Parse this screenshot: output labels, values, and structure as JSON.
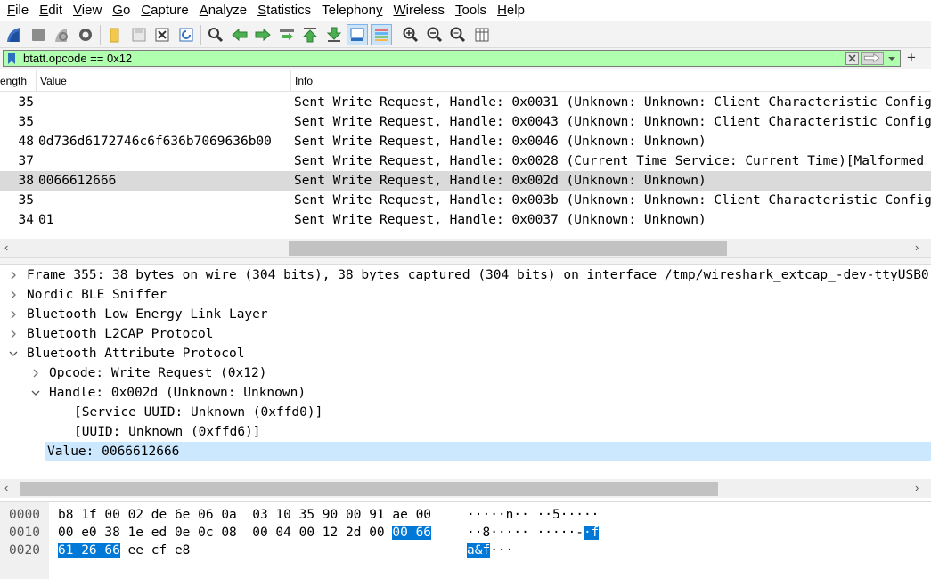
{
  "menu": [
    {
      "pre": "",
      "ul": "F",
      "post": "ile"
    },
    {
      "pre": "",
      "ul": "E",
      "post": "dit"
    },
    {
      "pre": "",
      "ul": "V",
      "post": "iew"
    },
    {
      "pre": "",
      "ul": "G",
      "post": "o"
    },
    {
      "pre": "",
      "ul": "C",
      "post": "apture"
    },
    {
      "pre": "",
      "ul": "A",
      "post": "nalyze"
    },
    {
      "pre": "",
      "ul": "S",
      "post": "tatistics"
    },
    {
      "pre": "Telephon",
      "ul": "y",
      "post": ""
    },
    {
      "pre": "",
      "ul": "W",
      "post": "ireless"
    },
    {
      "pre": "",
      "ul": "T",
      "post": "ools"
    },
    {
      "pre": "",
      "ul": "H",
      "post": "elp"
    }
  ],
  "toolbar_icons": [
    "start-capture-icon",
    "stop-capture-icon",
    "restart-capture-icon",
    "capture-options-icon",
    "open-file-icon",
    "save-file-icon",
    "close-file-icon",
    "reload-file-icon",
    "find-packet-icon",
    "go-back-icon",
    "go-forward-icon",
    "go-to-packet-icon",
    "go-first-icon",
    "go-last-icon",
    "autoscroll-icon",
    "colorize-icon",
    "zoom-in-icon",
    "zoom-out-icon",
    "zoom-normal-icon",
    "resize-columns-icon"
  ],
  "filter": {
    "value": "btatt.opcode == 0x12",
    "add_label": "+"
  },
  "packet_list": {
    "columns": [
      "ength",
      "Value",
      "Info"
    ],
    "rows": [
      {
        "length": "35",
        "value": "",
        "info": "Sent Write Request, Handle: 0x0031 (Unknown: Unknown: Client Characteristic Configuration)",
        "selected": false
      },
      {
        "length": "35",
        "value": "",
        "info": "Sent Write Request, Handle: 0x0043 (Unknown: Unknown: Client Characteristic Configuration)",
        "selected": false
      },
      {
        "length": "48",
        "value": "0d736d6172746c6f636b7069636b00",
        "info": "Sent Write Request, Handle: 0x0046 (Unknown: Unknown)",
        "selected": false
      },
      {
        "length": "37",
        "value": "",
        "info": "Sent Write Request, Handle: 0x0028 (Current Time Service: Current Time)[Malformed Packet]",
        "selected": false
      },
      {
        "length": "38",
        "value": "0066612666",
        "info": "Sent Write Request, Handle: 0x002d (Unknown: Unknown)",
        "selected": true
      },
      {
        "length": "35",
        "value": "",
        "info": "Sent Write Request, Handle: 0x003b (Unknown: Unknown: Client Characteristic Configuration)",
        "selected": false
      },
      {
        "length": "34",
        "value": "01",
        "info": "Sent Write Request, Handle: 0x0037 (Unknown: Unknown)",
        "selected": false
      }
    ]
  },
  "details": [
    {
      "text": "Frame 355: 38 bytes on wire (304 bits), 38 bytes captured (304 bits) on interface /tmp/wireshark_extcap_-dev-ttyUSB0",
      "depth": 0,
      "expander": "collapsed",
      "highlight": false
    },
    {
      "text": "Nordic BLE Sniffer",
      "depth": 0,
      "expander": "collapsed",
      "highlight": false
    },
    {
      "text": "Bluetooth Low Energy Link Layer",
      "depth": 0,
      "expander": "collapsed",
      "highlight": false
    },
    {
      "text": "Bluetooth L2CAP Protocol",
      "depth": 0,
      "expander": "collapsed",
      "highlight": false
    },
    {
      "text": "Bluetooth Attribute Protocol",
      "depth": 0,
      "expander": "expanded",
      "highlight": false
    },
    {
      "text": "Opcode: Write Request (0x12)",
      "depth": 1,
      "expander": "collapsed",
      "highlight": false
    },
    {
      "text": "Handle: 0x002d (Unknown: Unknown)",
      "depth": 1,
      "expander": "expanded",
      "highlight": false
    },
    {
      "text": "[Service UUID: Unknown (0xffd0)]",
      "depth": 2,
      "expander": "none",
      "highlight": false
    },
    {
      "text": "[UUID: Unknown (0xffd6)]",
      "depth": 2,
      "expander": "none",
      "highlight": false
    },
    {
      "text": "Value: 0066612666",
      "depth": 1,
      "expander": "none",
      "highlight": true
    }
  ],
  "bytes": [
    {
      "offset": "0000",
      "hex_plain": "b8 1f 00 02 de 6e 06 0a  03 10 35 90 00 91 ae 00",
      "hex_sel": "",
      "hex_pre_sel": "",
      "ascii_plain": "·····n·· ··5·····",
      "ascii_sel": "",
      "ascii_pre_sel": ""
    },
    {
      "offset": "0010",
      "hex_pre_sel": "00 e0 38 1e ed 0e 0c 08  00 04 00 12 2d 00 ",
      "hex_sel": "00 66",
      "hex_plain": "",
      "ascii_pre_sel": "··8····· ·····-",
      "ascii_sel": "·f",
      "ascii_plain": ""
    },
    {
      "offset": "0020",
      "hex_pre_sel": "",
      "hex_sel": "61 26 66",
      "hex_plain": " ee cf e8",
      "ascii_pre_sel": "",
      "ascii_sel": "a&f",
      "ascii_plain": "···"
    }
  ],
  "colors": {
    "filter_valid": "#afffaf",
    "row_selected": "#dadada",
    "detail_highlight": "#cce8ff",
    "byte_highlight": "#0078d7"
  }
}
